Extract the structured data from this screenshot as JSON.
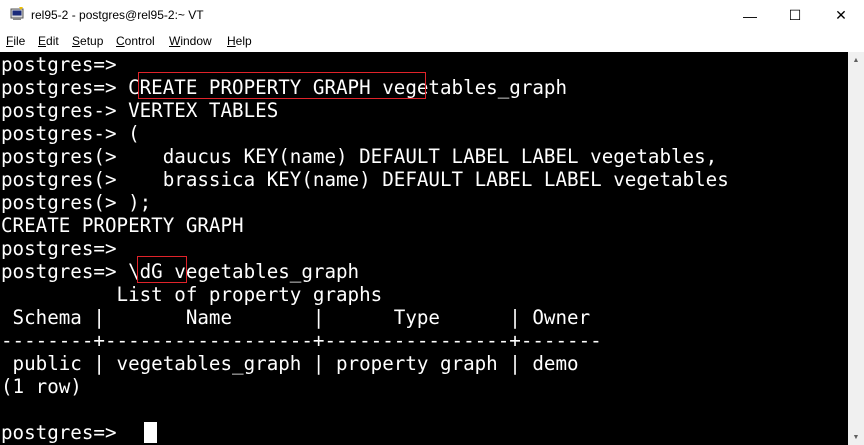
{
  "window": {
    "title": "rel95-2 - postgres@rel95-2:~ VT",
    "icon": "putty-terminal-icon",
    "minimize": "—",
    "maximize": "☐",
    "close": "✕"
  },
  "menu": [
    {
      "first": "F",
      "rest": "ile"
    },
    {
      "first": "E",
      "rest": "dit"
    },
    {
      "first": "S",
      "rest": "etup"
    },
    {
      "first": "C",
      "rest": "ontrol"
    },
    {
      "first": "W",
      "rest": "indow"
    },
    {
      "first": "H",
      "rest": "elp"
    }
  ],
  "terminal": {
    "lines": [
      "postgres=>",
      "postgres=> CREATE PROPERTY GRAPH vegetables_graph",
      "postgres-> VERTEX TABLES",
      "postgres-> (",
      "postgres(>    daucus KEY(name) DEFAULT LABEL LABEL vegetables,",
      "postgres(>    brassica KEY(name) DEFAULT LABEL LABEL vegetables",
      "postgres(> );",
      "CREATE PROPERTY GRAPH",
      "postgres=>",
      "postgres=> \\dG vegetables_graph",
      "          List of property graphs",
      " Schema |       Name       |      Type      | Owner",
      "--------+------------------+----------------+-------",
      " public | vegetables_graph | property graph | demo",
      "(1 row)",
      "",
      "postgres=> "
    ]
  },
  "colors": {
    "terminal_bg": "#000000",
    "terminal_fg": "#ffffff",
    "highlight": "#e0232a"
  }
}
